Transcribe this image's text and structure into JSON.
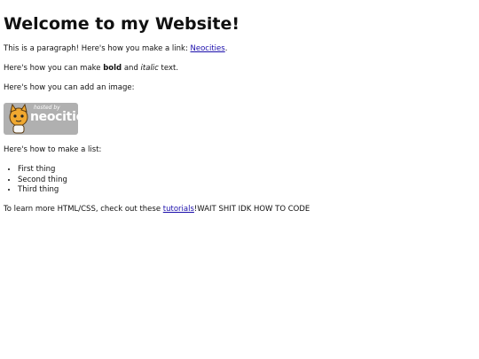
{
  "heading": "Welcome to my Website!",
  "para1": {
    "before": "This is a paragraph! Here's how you make a link: ",
    "link": "Neocities",
    "after": "."
  },
  "para2": {
    "before": "Here's how you can make ",
    "bold": "bold",
    "middle": " and ",
    "italic": "italic",
    "after": " text."
  },
  "para3": "Here's how you can add an image:",
  "badge": {
    "small": "hosted by",
    "big": "neocities"
  },
  "para4": "Here's how to make a list:",
  "list": [
    "First thing",
    "Second thing",
    "Third thing"
  ],
  "para5": {
    "before": "To learn more HTML/CSS, check out these ",
    "link": "tutorials",
    "after": "!WAIT SHIT IDK HOW TO CODE"
  }
}
